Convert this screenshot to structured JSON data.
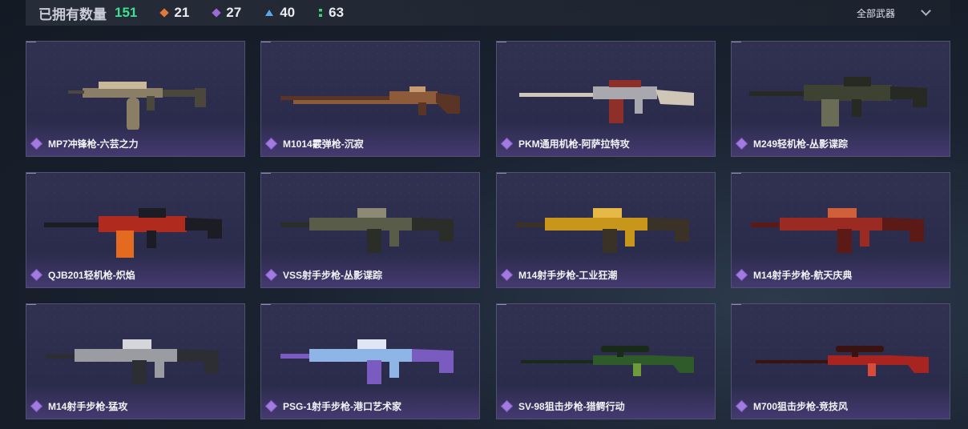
{
  "header": {
    "owned_label": "已拥有数量",
    "owned_count": "151",
    "rarity_counts": [
      {
        "icon": "orange-rarity-icon",
        "color": "#e07a35",
        "count": "21"
      },
      {
        "icon": "purple-rarity-icon",
        "color": "#9a6ad8",
        "count": "27"
      },
      {
        "icon": "blue-rarity-icon",
        "color": "#5aa8e8",
        "count": "40"
      },
      {
        "icon": "green-rarity-icon",
        "color": "#46d07a",
        "count": "63"
      }
    ],
    "filter_label": "全部武器"
  },
  "weapons": [
    {
      "name": "MP7冲锋枪-六芸之力",
      "palette": [
        "#8a7f66",
        "#4b473d",
        "#c9b89a"
      ]
    },
    {
      "name": "M1014霰弹枪-沉寂",
      "palette": [
        "#8e5b3a",
        "#5a3525",
        "#c89a70"
      ]
    },
    {
      "name": "PKM通用机枪-阿萨拉特攻",
      "palette": [
        "#a8a8ae",
        "#8e2f2a",
        "#d0c6b8"
      ]
    },
    {
      "name": "M249轻机枪-丛影谍踪",
      "palette": [
        "#3d4232",
        "#262a22",
        "#6a6c55"
      ]
    },
    {
      "name": "QJB201轻机枪-炽焰",
      "palette": [
        "#b02a1e",
        "#1c1c24",
        "#e46a20"
      ]
    },
    {
      "name": "VSS射手步枪-丛影谍踪",
      "palette": [
        "#5a5c4a",
        "#2b2d28",
        "#8c8a74"
      ]
    },
    {
      "name": "M14射手步枪-工业狂潮",
      "palette": [
        "#c9961c",
        "#3a3226",
        "#e6b845"
      ]
    },
    {
      "name": "M14射手步枪-航天庆典",
      "palette": [
        "#9a2a22",
        "#5b1a16",
        "#d0603a"
      ]
    },
    {
      "name": "M14射手步枪-猛攻",
      "palette": [
        "#9a9ca2",
        "#2c2e34",
        "#d4d6dc"
      ]
    },
    {
      "name": "PSG-1射手步枪-港口艺术家",
      "palette": [
        "#8fb4e6",
        "#7a5cc0",
        "#e0e6f4"
      ]
    },
    {
      "name": "SV-98狙击步枪-猎鳄行动",
      "palette": [
        "#2f5a2a",
        "#1a2a18",
        "#6e9a3a"
      ]
    },
    {
      "name": "M700狙击步枪-竞技风",
      "palette": [
        "#a82420",
        "#3a1210",
        "#d84a3a"
      ]
    }
  ]
}
